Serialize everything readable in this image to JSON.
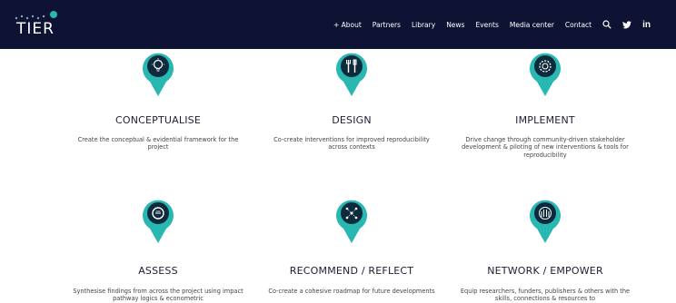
{
  "logo": {
    "text": "TIER"
  },
  "nav": {
    "links": [
      "+ About",
      "Partners",
      "Library",
      "News",
      "Events",
      "Media center",
      "Contact"
    ],
    "icons": [
      "search-icon",
      "twitter-icon",
      "linkedin-icon"
    ],
    "linkedin_text": "in"
  },
  "colors": {
    "navbar": "#0e1233",
    "marker": "#29b7b1",
    "marker_inner": "#0e2a3d"
  },
  "cards": [
    {
      "title": "CONCEPTUALISE",
      "description": "Create the conceptual & evidential framework for the project",
      "icon": "lightbulb-icon"
    },
    {
      "title": "DESIGN",
      "description": "Co-create interventions for improved reproducibility across contexts",
      "icon": "tools-icon"
    },
    {
      "title": "IMPLEMENT",
      "description": "Drive change through community-driven stakeholder development & piloting of new interventions & tools for reproducibility",
      "icon": "gear-icon"
    },
    {
      "title": "ASSESS",
      "description": "Synthesise findings from across the project using impact pathway logics & econometric",
      "icon": "magnifier-icon"
    },
    {
      "title": "RECOMMEND / REFLECT",
      "description": "Co-create a cohesive roadmap for future developments",
      "icon": "roadmap-icon"
    },
    {
      "title": "NETWORK / EMPOWER",
      "description": "Equip researchers, funders, publishers & others with the skills, connections & resources to",
      "icon": "network-icon"
    }
  ]
}
